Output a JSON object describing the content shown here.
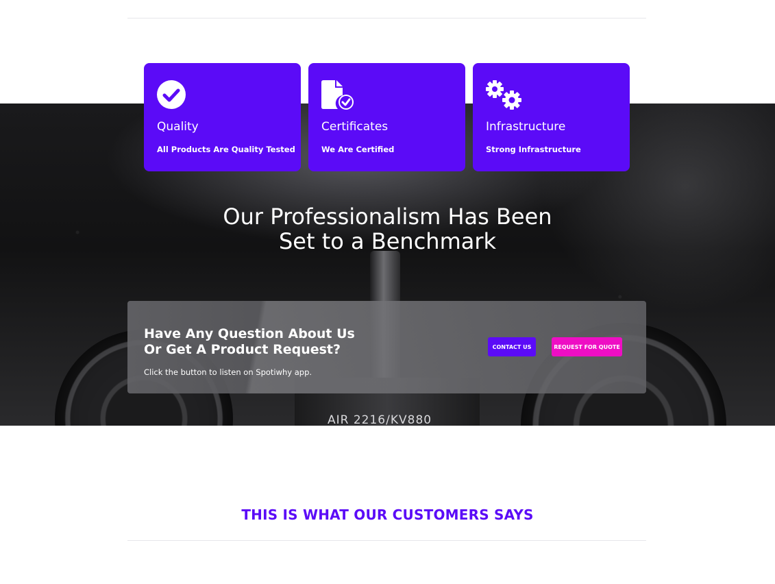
{
  "features": [
    {
      "icon": "check-circle-icon",
      "title": "Quality",
      "subtitle": "All Products Are Quality Tested"
    },
    {
      "icon": "certificate-document-icon",
      "title": "Certificates",
      "subtitle": "We Are Certified"
    },
    {
      "icon": "gears-icon",
      "title": "Infrastructure",
      "subtitle": "Strong Infrastructure"
    }
  ],
  "hero": {
    "headline_line1": "Our Professionalism Has Been",
    "headline_line2": "Set to a Benchmark",
    "product_text": "AIR 2216/KV880"
  },
  "cta": {
    "question_line1": "Have Any Question About Us",
    "question_line2": "Or Get A Product Request?",
    "note": "Click the button to listen on Spotiwhy app.",
    "contact_label": "CONTACT US",
    "quote_label": "REQUEST FOR QUOTE"
  },
  "testimonials": {
    "heading": "THIS IS WHAT OUR CUSTOMERS SAYS"
  },
  "colors": {
    "primary": "#5b0bf7",
    "accent": "#ee0ec4",
    "white": "#ffffff"
  }
}
